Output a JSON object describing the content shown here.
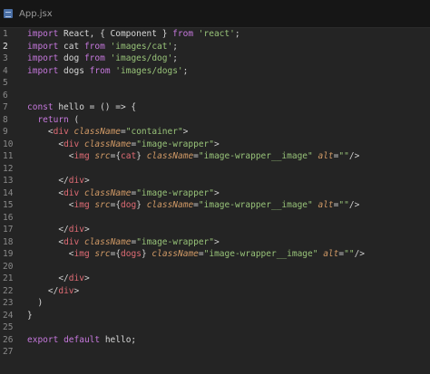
{
  "tab": {
    "title": "App.jsx",
    "icon": "file-icon"
  },
  "editor": {
    "active_line": 2,
    "lines": [
      {
        "n": "1",
        "tokens": [
          [
            "kw",
            "import"
          ],
          [
            "plain",
            " React, { Component } "
          ],
          [
            "kw",
            "from"
          ],
          [
            "plain",
            " "
          ],
          [
            "strg",
            "'react'"
          ],
          [
            "punc",
            ";"
          ]
        ]
      },
      {
        "n": "2",
        "tokens": [
          [
            "kw",
            "import"
          ],
          [
            "plain",
            " cat "
          ],
          [
            "kw",
            "from"
          ],
          [
            "plain",
            " "
          ],
          [
            "strg",
            "'images/cat'"
          ],
          [
            "punc",
            ";"
          ]
        ]
      },
      {
        "n": "3",
        "tokens": [
          [
            "kw",
            "import"
          ],
          [
            "plain",
            " dog "
          ],
          [
            "kw",
            "from"
          ],
          [
            "plain",
            " "
          ],
          [
            "strg",
            "'images/dog'"
          ],
          [
            "punc",
            ";"
          ]
        ]
      },
      {
        "n": "4",
        "tokens": [
          [
            "kw",
            "import"
          ],
          [
            "plain",
            " dogs "
          ],
          [
            "kw",
            "from"
          ],
          [
            "plain",
            " "
          ],
          [
            "strg",
            "'images/dogs'"
          ],
          [
            "punc",
            ";"
          ]
        ]
      },
      {
        "n": "5",
        "tokens": []
      },
      {
        "n": "6",
        "tokens": []
      },
      {
        "n": "7",
        "tokens": [
          [
            "kw",
            "const"
          ],
          [
            "plain",
            " hello = () => {"
          ]
        ]
      },
      {
        "n": "8",
        "tokens": [
          [
            "plain",
            "  "
          ],
          [
            "kw",
            "return"
          ],
          [
            "plain",
            " ("
          ]
        ]
      },
      {
        "n": "9",
        "tokens": [
          [
            "plain",
            "    "
          ],
          [
            "punc",
            "<"
          ],
          [
            "tag",
            "div"
          ],
          [
            "plain",
            " "
          ],
          [
            "attr",
            "className"
          ],
          [
            "punc",
            "="
          ],
          [
            "strg",
            "\"container\""
          ],
          [
            "punc",
            ">"
          ]
        ]
      },
      {
        "n": "10",
        "tokens": [
          [
            "plain",
            "      "
          ],
          [
            "punc",
            "<"
          ],
          [
            "tag",
            "div"
          ],
          [
            "plain",
            " "
          ],
          [
            "attr",
            "className"
          ],
          [
            "punc",
            "="
          ],
          [
            "strg",
            "\"image-wrapper\""
          ],
          [
            "punc",
            ">"
          ]
        ]
      },
      {
        "n": "11",
        "tokens": [
          [
            "plain",
            "        "
          ],
          [
            "punc",
            "<"
          ],
          [
            "tag",
            "img"
          ],
          [
            "plain",
            " "
          ],
          [
            "attr",
            "src"
          ],
          [
            "punc",
            "="
          ],
          [
            "punc",
            "{"
          ],
          [
            "var",
            "cat"
          ],
          [
            "punc",
            "}"
          ],
          [
            "plain",
            " "
          ],
          [
            "attr",
            "className"
          ],
          [
            "punc",
            "="
          ],
          [
            "strg",
            "\"image-wrapper__image\""
          ],
          [
            "plain",
            " "
          ],
          [
            "attr",
            "alt"
          ],
          [
            "punc",
            "="
          ],
          [
            "strg",
            "\"\""
          ],
          [
            "punc",
            "/>"
          ]
        ]
      },
      {
        "n": "12",
        "tokens": []
      },
      {
        "n": "13",
        "tokens": [
          [
            "plain",
            "      "
          ],
          [
            "punc",
            "</"
          ],
          [
            "tag",
            "div"
          ],
          [
            "punc",
            ">"
          ]
        ]
      },
      {
        "n": "14",
        "tokens": [
          [
            "plain",
            "      "
          ],
          [
            "punc",
            "<"
          ],
          [
            "tag",
            "div"
          ],
          [
            "plain",
            " "
          ],
          [
            "attr",
            "className"
          ],
          [
            "punc",
            "="
          ],
          [
            "strg",
            "\"image-wrapper\""
          ],
          [
            "punc",
            ">"
          ]
        ]
      },
      {
        "n": "15",
        "tokens": [
          [
            "plain",
            "        "
          ],
          [
            "punc",
            "<"
          ],
          [
            "tag",
            "img"
          ],
          [
            "plain",
            " "
          ],
          [
            "attr",
            "src"
          ],
          [
            "punc",
            "="
          ],
          [
            "punc",
            "{"
          ],
          [
            "var",
            "dog"
          ],
          [
            "punc",
            "}"
          ],
          [
            "plain",
            " "
          ],
          [
            "attr",
            "className"
          ],
          [
            "punc",
            "="
          ],
          [
            "strg",
            "\"image-wrapper__image\""
          ],
          [
            "plain",
            " "
          ],
          [
            "attr",
            "alt"
          ],
          [
            "punc",
            "="
          ],
          [
            "strg",
            "\"\""
          ],
          [
            "punc",
            "/>"
          ]
        ]
      },
      {
        "n": "16",
        "tokens": []
      },
      {
        "n": "17",
        "tokens": [
          [
            "plain",
            "      "
          ],
          [
            "punc",
            "</"
          ],
          [
            "tag",
            "div"
          ],
          [
            "punc",
            ">"
          ]
        ]
      },
      {
        "n": "18",
        "tokens": [
          [
            "plain",
            "      "
          ],
          [
            "punc",
            "<"
          ],
          [
            "tag",
            "div"
          ],
          [
            "plain",
            " "
          ],
          [
            "attr",
            "className"
          ],
          [
            "punc",
            "="
          ],
          [
            "strg",
            "\"image-wrapper\""
          ],
          [
            "punc",
            ">"
          ]
        ]
      },
      {
        "n": "19",
        "tokens": [
          [
            "plain",
            "        "
          ],
          [
            "punc",
            "<"
          ],
          [
            "tag",
            "img"
          ],
          [
            "plain",
            " "
          ],
          [
            "attr",
            "src"
          ],
          [
            "punc",
            "="
          ],
          [
            "punc",
            "{"
          ],
          [
            "var",
            "dogs"
          ],
          [
            "punc",
            "}"
          ],
          [
            "plain",
            " "
          ],
          [
            "attr",
            "className"
          ],
          [
            "punc",
            "="
          ],
          [
            "strg",
            "\"image-wrapper__image\""
          ],
          [
            "plain",
            " "
          ],
          [
            "attr",
            "alt"
          ],
          [
            "punc",
            "="
          ],
          [
            "strg",
            "\"\""
          ],
          [
            "punc",
            "/>"
          ]
        ]
      },
      {
        "n": "20",
        "tokens": []
      },
      {
        "n": "21",
        "tokens": [
          [
            "plain",
            "      "
          ],
          [
            "punc",
            "</"
          ],
          [
            "tag",
            "div"
          ],
          [
            "punc",
            ">"
          ]
        ]
      },
      {
        "n": "22",
        "tokens": [
          [
            "plain",
            "    "
          ],
          [
            "punc",
            "</"
          ],
          [
            "tag",
            "div"
          ],
          [
            "punc",
            ">"
          ]
        ]
      },
      {
        "n": "23",
        "tokens": [
          [
            "plain",
            "  )"
          ]
        ]
      },
      {
        "n": "24",
        "tokens": [
          [
            "plain",
            "}"
          ]
        ]
      },
      {
        "n": "25",
        "tokens": []
      },
      {
        "n": "26",
        "tokens": [
          [
            "kw",
            "export"
          ],
          [
            "plain",
            " "
          ],
          [
            "kw",
            "default"
          ],
          [
            "plain",
            " hello;"
          ]
        ]
      },
      {
        "n": "27",
        "tokens": []
      }
    ]
  }
}
